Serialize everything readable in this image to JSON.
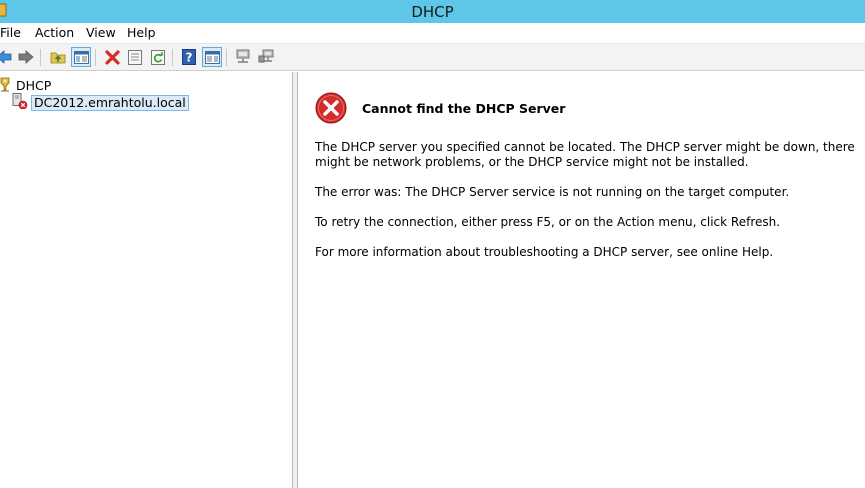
{
  "window": {
    "title": "DHCP"
  },
  "menu": {
    "items": [
      "File",
      "Action",
      "View",
      "Help"
    ]
  },
  "toolbar": {
    "buttons": [
      "back-icon",
      "forward-icon",
      "up-folder-icon",
      "show-hide-console-tree-icon",
      "delete-icon",
      "properties-icon",
      "refresh-icon",
      "help-icon",
      "action-pane-icon",
      "server-icon",
      "server-options-icon"
    ]
  },
  "tree": {
    "root_label": "DHCP",
    "server_label": "DC2012.emrahtolu.local"
  },
  "error": {
    "title": "Cannot find the DHCP Server",
    "paragraph1": "The DHCP server you specified cannot be located. The DHCP server might be down, there might be network problems, or the DHCP service might not be installed.",
    "paragraph2": "The error was:  The DHCP Server service is not running on the target computer.",
    "paragraph3": "To retry the connection, either press F5, or on the Action menu, click Refresh.",
    "paragraph4": "For more information about troubleshooting a DHCP server, see online Help."
  },
  "colors": {
    "titlebar": "#5ec6e9",
    "selection": "#dbeaf9",
    "error_red": "#d42b2b"
  }
}
